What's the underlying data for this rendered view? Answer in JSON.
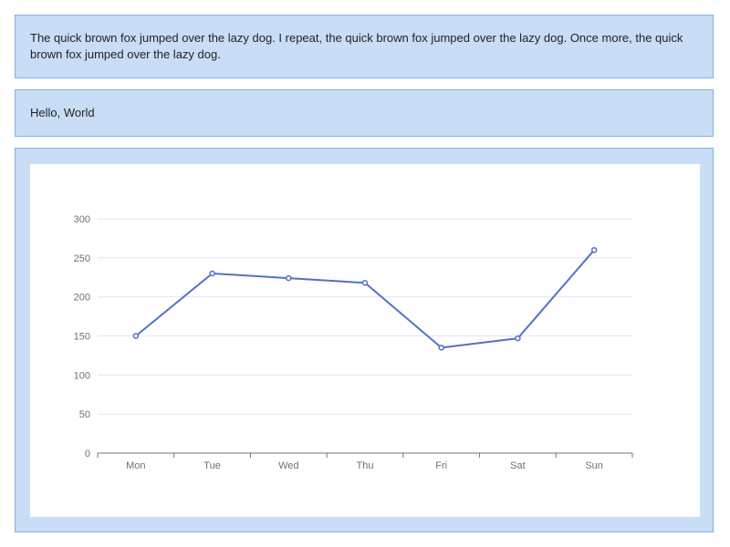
{
  "panels": {
    "paragraph": "The quick brown fox jumped over the lazy dog. I repeat, the quick brown fox jumped over the lazy dog. Once more, the quick brown fox jumped over the lazy dog.",
    "greeting": "Hello, World"
  },
  "colors": {
    "panel_background": "#c9ddf7",
    "panel_border": "#7fb2df",
    "series_line": "#5470c6",
    "grid_line": "#e0e6f1",
    "axis_line": "#6e7079"
  },
  "chart_data": {
    "type": "line",
    "categories": [
      "Mon",
      "Tue",
      "Wed",
      "Thu",
      "Fri",
      "Sat",
      "Sun"
    ],
    "values": [
      150,
      230,
      224,
      218,
      135,
      147,
      260
    ],
    "ylim": [
      0,
      300
    ],
    "yticks": [
      0,
      50,
      100,
      150,
      200,
      250,
      300
    ],
    "grid": true,
    "legend": "none"
  }
}
